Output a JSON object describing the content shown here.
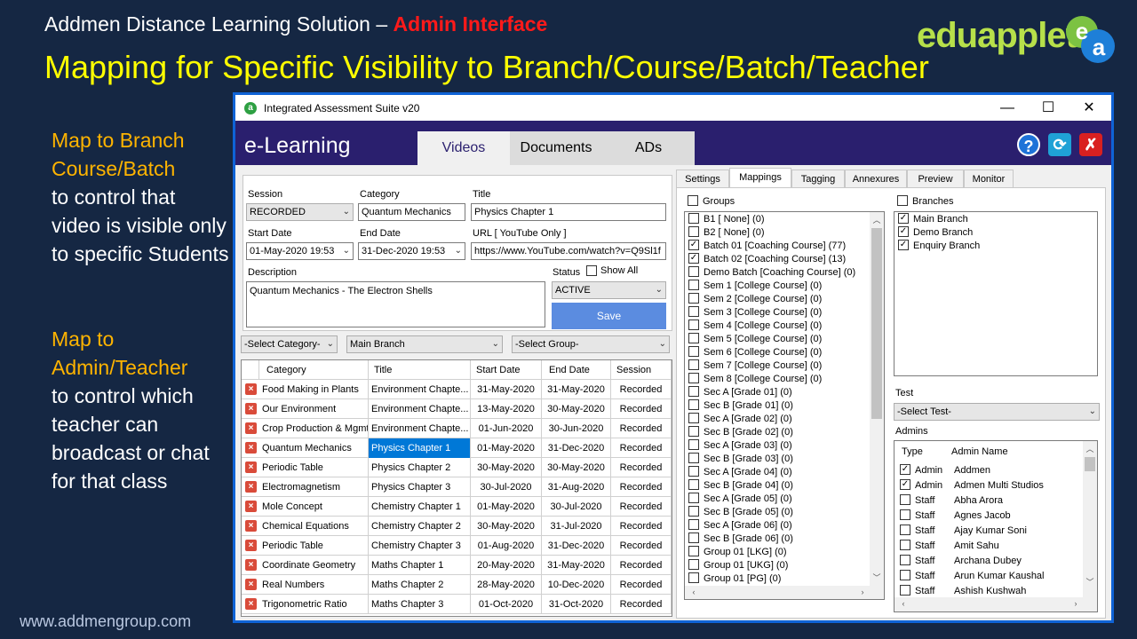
{
  "slide": {
    "header_prefix": "Addmen Distance Learning Solution – ",
    "header_highlight": "Admin Interface",
    "title": "Mapping for Specific Visibility to Branch/Course/Batch/Teacher",
    "brand": "eduapplet",
    "logo_letters": "ea",
    "block1_highlight_1": "Map to Branch",
    "block1_highlight_2": "Course/Batch",
    "block1_text": "to control that video is visible only to specific Students",
    "block2_highlight_1": "Map to",
    "block2_highlight_2": "Admin/Teacher",
    "block2_text": "to control  which teacher can broadcast or chat for that class",
    "footer_url": "www.addmengroup.com"
  },
  "window": {
    "title": "Integrated Assessment Suite v20",
    "app_icon": "a",
    "minimize": "—",
    "maximize": "☐",
    "close": "✕"
  },
  "app": {
    "name": "e-Learning",
    "tabs": [
      "Videos",
      "Documents",
      "ADs"
    ],
    "icons": [
      "help-icon",
      "refresh-icon",
      "close-icon"
    ]
  },
  "form": {
    "session_label": "Session",
    "session_value": "RECORDED",
    "category_label": "Category",
    "category_value": "Quantum Mechanics",
    "title_label": "Title",
    "title_value": "Physics Chapter 1",
    "start_label": "Start Date",
    "start_value": "01-May-2020 19:53",
    "end_label": "End Date",
    "end_value": "31-Dec-2020 19:53",
    "url_label": "URL [ YouTube Only ]",
    "url_value": "https://www.YouTube.com/watch?v=Q9Sl1f",
    "desc_label": "Description",
    "desc_value": "Quantum Mechanics - The Electron Shells",
    "status_label": "Status",
    "show_all_label": "Show All",
    "status_value": "ACTIVE",
    "save_label": "Save"
  },
  "filters": {
    "category": "-Select Category-",
    "branch": "Main Branch",
    "group": "-Select Group-"
  },
  "table": {
    "columns": [
      "Category",
      "Title",
      "Start Date",
      "End Date",
      "Session"
    ],
    "rows": [
      [
        "Food Making in Plants",
        "Environment Chapte...",
        "31-May-2020",
        "31-May-2020",
        "Recorded"
      ],
      [
        "Our Environment",
        "Environment Chapte...",
        "13-May-2020",
        "30-May-2020",
        "Recorded"
      ],
      [
        "Crop Production & Mgmt",
        "Environment Chapte...",
        "01-Jun-2020",
        "30-Jun-2020",
        "Recorded"
      ],
      [
        "Quantum Mechanics",
        "Physics Chapter 1",
        "01-May-2020",
        "31-Dec-2020",
        "Recorded"
      ],
      [
        "Periodic Table",
        "Physics Chapter 2",
        "30-May-2020",
        "30-May-2020",
        "Recorded"
      ],
      [
        "Electromagnetism",
        "Physics Chapter 3",
        "30-Jul-2020",
        "31-Aug-2020",
        "Recorded"
      ],
      [
        "Mole Concept",
        "Chemistry Chapter 1",
        "01-May-2020",
        "30-Jul-2020",
        "Recorded"
      ],
      [
        "Chemical Equations",
        "Chemistry Chapter 2",
        "30-May-2020",
        "31-Jul-2020",
        "Recorded"
      ],
      [
        "Periodic Table",
        "Chemistry Chapter 3",
        "01-Aug-2020",
        "31-Dec-2020",
        "Recorded"
      ],
      [
        "Coordinate Geometry",
        "Maths Chapter 1",
        "20-May-2020",
        "31-May-2020",
        "Recorded"
      ],
      [
        "Real Numbers",
        "Maths Chapter 2",
        "28-May-2020",
        "10-Dec-2020",
        "Recorded"
      ],
      [
        "Trigonometric Ratio",
        "Maths Chapter 3",
        "01-Oct-2020",
        "31-Oct-2020",
        "Recorded"
      ]
    ]
  },
  "right_tabs": [
    "Settings",
    "Mappings",
    "Tagging",
    "Annexures",
    "Preview",
    "Monitor"
  ],
  "groups": {
    "label": "Groups",
    "items": [
      {
        "label": "B1 [ None] (0)",
        "checked": false
      },
      {
        "label": "B2 [ None] (0)",
        "checked": false
      },
      {
        "label": "Batch 01 [Coaching Course] (77)",
        "checked": true
      },
      {
        "label": "Batch 02 [Coaching Course] (13)",
        "checked": true
      },
      {
        "label": "Demo Batch [Coaching Course] (0)",
        "checked": false
      },
      {
        "label": "Sem 1 [College Course] (0)",
        "checked": false
      },
      {
        "label": "Sem 2 [College Course] (0)",
        "checked": false
      },
      {
        "label": "Sem 3 [College Course] (0)",
        "checked": false
      },
      {
        "label": "Sem 4 [College Course] (0)",
        "checked": false
      },
      {
        "label": "Sem 5 [College Course] (0)",
        "checked": false
      },
      {
        "label": "Sem 6 [College Course] (0)",
        "checked": false
      },
      {
        "label": "Sem 7 [College Course] (0)",
        "checked": false
      },
      {
        "label": "Sem 8 [College Course] (0)",
        "checked": false
      },
      {
        "label": "Sec A [Grade 01] (0)",
        "checked": false
      },
      {
        "label": "Sec B [Grade 01] (0)",
        "checked": false
      },
      {
        "label": "Sec A [Grade 02] (0)",
        "checked": false
      },
      {
        "label": "Sec B [Grade 02] (0)",
        "checked": false
      },
      {
        "label": "Sec A [Grade 03] (0)",
        "checked": false
      },
      {
        "label": "Sec B [Grade 03] (0)",
        "checked": false
      },
      {
        "label": "Sec A [Grade 04] (0)",
        "checked": false
      },
      {
        "label": "Sec B [Grade 04] (0)",
        "checked": false
      },
      {
        "label": "Sec A [Grade 05] (0)",
        "checked": false
      },
      {
        "label": "Sec B [Grade 05] (0)",
        "checked": false
      },
      {
        "label": "Sec A [Grade 06] (0)",
        "checked": false
      },
      {
        "label": "Sec B [Grade 06] (0)",
        "checked": false
      },
      {
        "label": "Group 01 [LKG] (0)",
        "checked": false
      },
      {
        "label": "Group 01 [UKG] (0)",
        "checked": false
      },
      {
        "label": "Group 01 [PG] (0)",
        "checked": false
      }
    ]
  },
  "branches": {
    "label": "Branches",
    "items": [
      {
        "label": "Main Branch",
        "checked": true
      },
      {
        "label": "Demo Branch",
        "checked": true
      },
      {
        "label": "Enquiry Branch",
        "checked": true
      }
    ]
  },
  "test": {
    "label": "Test",
    "value": "-Select Test-"
  },
  "admins": {
    "label": "Admins",
    "columns": [
      "Type",
      "Admin Name"
    ],
    "rows": [
      {
        "type": "Admin",
        "name": "Addmen",
        "checked": true
      },
      {
        "type": "Admin",
        "name": "Admen Multi Studios",
        "checked": true
      },
      {
        "type": "Staff",
        "name": "Abha Arora",
        "checked": false
      },
      {
        "type": "Staff",
        "name": "Agnes Jacob",
        "checked": false
      },
      {
        "type": "Staff",
        "name": "Ajay Kumar Soni",
        "checked": false
      },
      {
        "type": "Staff",
        "name": "Amit Sahu",
        "checked": false
      },
      {
        "type": "Staff",
        "name": "Archana Dubey",
        "checked": false
      },
      {
        "type": "Staff",
        "name": "Arun Kumar Kaushal",
        "checked": false
      },
      {
        "type": "Staff",
        "name": "Ashish Kushwah",
        "checked": false
      }
    ]
  }
}
